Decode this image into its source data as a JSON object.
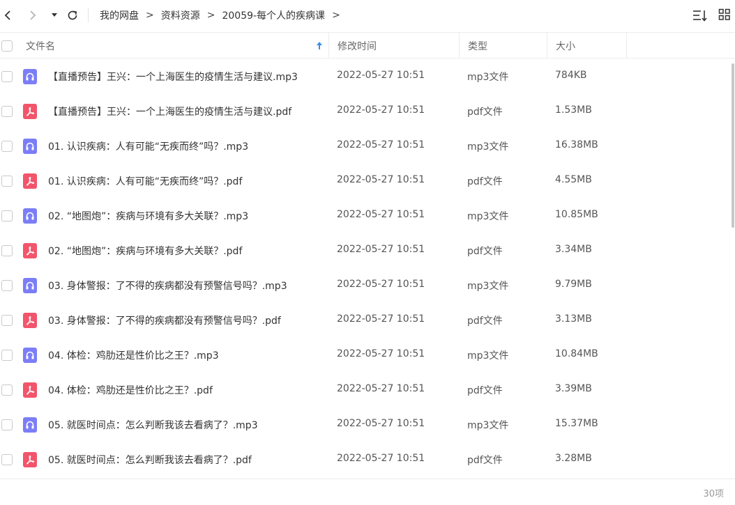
{
  "toolbar": {
    "icons": [
      "back-arrow-icon",
      "forward-arrow-icon",
      "dropdown-caret-icon",
      "refresh-icon",
      "sort-list-icon",
      "grid-view-icon"
    ]
  },
  "breadcrumb": {
    "items": [
      "我的网盘",
      "资料资源",
      "20059-每个人的疾病课"
    ],
    "separator": ">"
  },
  "columns": {
    "name": "文件名",
    "mtime": "修改时间",
    "type": "类型",
    "size": "大小"
  },
  "files": [
    {
      "name": "【直播预告】王兴：一个上海医生的疫情生活与建议.mp3",
      "mtime": "2022-05-27 10:51",
      "type": "mp3文件",
      "size": "784KB",
      "kind": "mp3"
    },
    {
      "name": "【直播预告】王兴：一个上海医生的疫情生活与建议.pdf",
      "mtime": "2022-05-27 10:51",
      "type": "pdf文件",
      "size": "1.53MB",
      "kind": "pdf"
    },
    {
      "name": "01. 认识疾病：人有可能“无疾而终”吗？.mp3",
      "mtime": "2022-05-27 10:51",
      "type": "mp3文件",
      "size": "16.38MB",
      "kind": "mp3"
    },
    {
      "name": "01. 认识疾病：人有可能“无疾而终”吗？.pdf",
      "mtime": "2022-05-27 10:51",
      "type": "pdf文件",
      "size": "4.55MB",
      "kind": "pdf"
    },
    {
      "name": "02. “地图炮”：疾病与环境有多大关联？.mp3",
      "mtime": "2022-05-27 10:51",
      "type": "mp3文件",
      "size": "10.85MB",
      "kind": "mp3"
    },
    {
      "name": "02. “地图炮”：疾病与环境有多大关联？.pdf",
      "mtime": "2022-05-27 10:51",
      "type": "pdf文件",
      "size": "3.34MB",
      "kind": "pdf"
    },
    {
      "name": "03. 身体警报：了不得的疾病都没有预警信号吗？.mp3",
      "mtime": "2022-05-27 10:51",
      "type": "mp3文件",
      "size": "9.79MB",
      "kind": "mp3"
    },
    {
      "name": "03. 身体警报：了不得的疾病都没有预警信号吗？.pdf",
      "mtime": "2022-05-27 10:51",
      "type": "pdf文件",
      "size": "3.13MB",
      "kind": "pdf"
    },
    {
      "name": "04. 体检：鸡肋还是性价比之王？.mp3",
      "mtime": "2022-05-27 10:51",
      "type": "mp3文件",
      "size": "10.84MB",
      "kind": "mp3"
    },
    {
      "name": "04. 体检：鸡肋还是性价比之王？.pdf",
      "mtime": "2022-05-27 10:51",
      "type": "pdf文件",
      "size": "3.39MB",
      "kind": "pdf"
    },
    {
      "name": "05. 就医时间点：怎么判断我该去看病了？.mp3",
      "mtime": "2022-05-27 10:51",
      "type": "mp3文件",
      "size": "15.37MB",
      "kind": "mp3"
    },
    {
      "name": "05. 就医时间点：怎么判断我该去看病了？.pdf",
      "mtime": "2022-05-27 10:51",
      "type": "pdf文件",
      "size": "3.28MB",
      "kind": "pdf"
    }
  ],
  "footer": {
    "count": "30项"
  },
  "colors": {
    "mp3": "#7b7ef6",
    "pdf": "#f2556b",
    "sort_arrow": "#3a8ee6"
  }
}
